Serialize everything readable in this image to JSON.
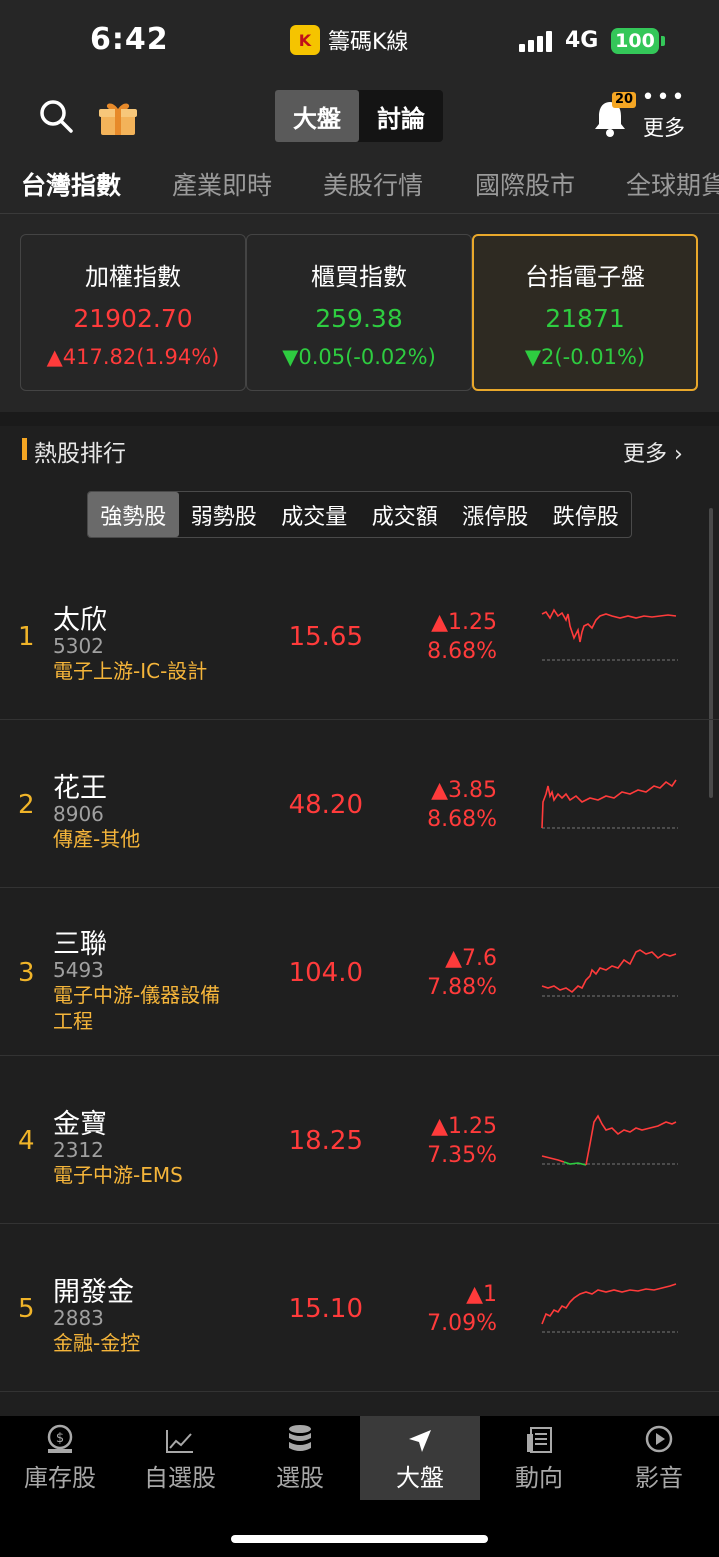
{
  "status_bar": {
    "time": "6:42",
    "app_name": "籌碼K線",
    "network": "4G",
    "battery": "100"
  },
  "top_nav": {
    "segments": [
      "大盤",
      "討論"
    ],
    "active_segment": "大盤",
    "notification_count": "20",
    "more_label": "更多"
  },
  "category_tabs": [
    "台灣指數",
    "產業即時",
    "美股行情",
    "國際股市",
    "全球期貨"
  ],
  "index_cards": [
    {
      "name": "加權指數",
      "value": "21902.70",
      "change": "▲417.82(1.94%)",
      "direction": "up"
    },
    {
      "name": "櫃買指數",
      "value": "259.38",
      "change": "▼0.05(-0.02%)",
      "direction": "down"
    },
    {
      "name": "台指電子盤",
      "value": "21871",
      "change": "▼2(-0.01%)",
      "direction": "down"
    }
  ],
  "hot_stocks": {
    "title": "熱股排行",
    "more_label": "更多",
    "filters": [
      "強勢股",
      "弱勢股",
      "成交量",
      "成交額",
      "漲停股",
      "跌停股"
    ],
    "active_filter": "強勢股",
    "rows": [
      {
        "rank": "1",
        "name": "太欣",
        "code": "5302",
        "industry": "電子上游-IC-設計",
        "price": "15.65",
        "change": "▲1.25",
        "percent": "8.68%"
      },
      {
        "rank": "2",
        "name": "花王",
        "code": "8906",
        "industry": "傳產-其他",
        "price": "48.20",
        "change": "▲3.85",
        "percent": "8.68%"
      },
      {
        "rank": "3",
        "name": "三聯",
        "code": "5493",
        "industry": "電子中游-儀器設備工程",
        "price": "104.0",
        "change": "▲7.6",
        "percent": "7.88%"
      },
      {
        "rank": "4",
        "name": "金寶",
        "code": "2312",
        "industry": "電子中游-EMS",
        "price": "18.25",
        "change": "▲1.25",
        "percent": "7.35%"
      },
      {
        "rank": "5",
        "name": "開發金",
        "code": "2883",
        "industry": "金融-金控",
        "price": "15.10",
        "change": "▲1",
        "percent": "7.09%"
      }
    ]
  },
  "bottom_nav": {
    "items": [
      "庫存股",
      "自選股",
      "選股",
      "大盤",
      "動向",
      "影音"
    ],
    "active": "大盤"
  },
  "colors": {
    "up": "#ff3b3b",
    "down": "#2ecc40",
    "accent": "#f5a623",
    "industry": "#f5b53a"
  }
}
